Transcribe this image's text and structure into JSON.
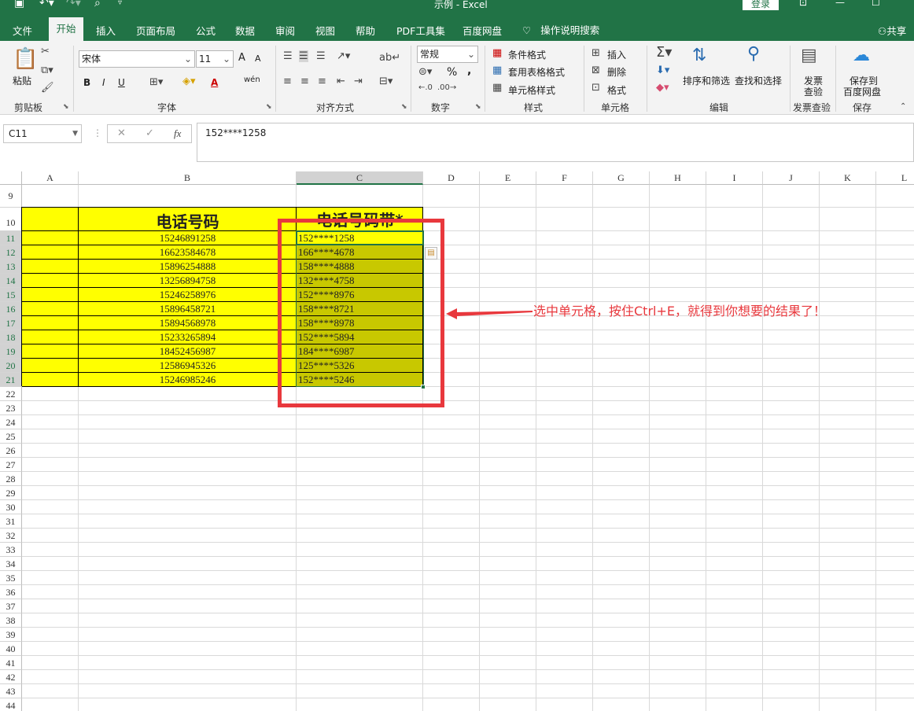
{
  "titlebar": {
    "title": "示例 - Excel",
    "login": "登录"
  },
  "tabs": [
    "文件",
    "开始",
    "插入",
    "页面布局",
    "公式",
    "数据",
    "审阅",
    "视图",
    "帮助",
    "PDF工具集",
    "百度网盘"
  ],
  "tell_me": "操作说明搜索",
  "share": "共享",
  "ribbon": {
    "clipboard": {
      "paste": "粘贴",
      "label": "剪贴板"
    },
    "font": {
      "name": "宋体",
      "size": "11",
      "label": "字体",
      "grow": "A",
      "shrink": "A",
      "bold": "B",
      "italic": "I",
      "underline": "U",
      "color_a": "A",
      "phonetic": "wén"
    },
    "alignment": {
      "label": "对齐方式"
    },
    "number": {
      "format": "常规",
      "label": "数字",
      "percent": "%",
      "comma": ","
    },
    "styles": {
      "conditional": "条件格式",
      "table": "套用表格格式",
      "cell": "单元格样式",
      "label": "样式"
    },
    "cells": {
      "insert": "插入",
      "delete": "删除",
      "format": "格式",
      "label": "单元格"
    },
    "editing": {
      "sort": "排序和筛选",
      "find": "查找和选择",
      "label": "编辑"
    },
    "invoice": {
      "btn1": "发票",
      "btn2": "查验",
      "label": "发票查验"
    },
    "save": {
      "btn1": "保存到",
      "btn2": "百度网盘",
      "label": "保存"
    }
  },
  "formula_bar": {
    "name_box": "C11",
    "fx": "fx",
    "content": "152****1258"
  },
  "sheet": {
    "columns": [
      "A",
      "B",
      "C",
      "D",
      "E",
      "F",
      "G",
      "H",
      "I",
      "J",
      "K",
      "L"
    ],
    "rows": [
      "9",
      "10",
      "11",
      "12",
      "13",
      "14",
      "15",
      "16",
      "17",
      "18",
      "19",
      "20",
      "21",
      "22",
      "23",
      "24",
      "25",
      "26",
      "27",
      "28",
      "29",
      "30",
      "31",
      "32",
      "33",
      "34",
      "35",
      "36",
      "37",
      "38",
      "39",
      "40",
      "41",
      "42",
      "43",
      "44"
    ],
    "header_b": "电话号码",
    "header_c": "电话号码带*",
    "phones": [
      "15246891258",
      "16623584678",
      "15896254888",
      "13256894758",
      "15246258976",
      "15896458721",
      "15894568978",
      "15233265894",
      "18452456987",
      "12586945326",
      "15246985246"
    ],
    "masked": [
      "152****1258",
      "166****4678",
      "158****4888",
      "132****4758",
      "152****8976",
      "158****8721",
      "158****8978",
      "152****5894",
      "184****6987",
      "125****5326",
      "152****5246"
    ]
  },
  "annotation": "选中单元格，按住Ctrl+E，就得到你想要的结果了！",
  "colors": {
    "excel_green": "#217346",
    "cell_yellow": "#ffff00",
    "selection": "#c8c800",
    "annotation_red": "#e8383d"
  }
}
